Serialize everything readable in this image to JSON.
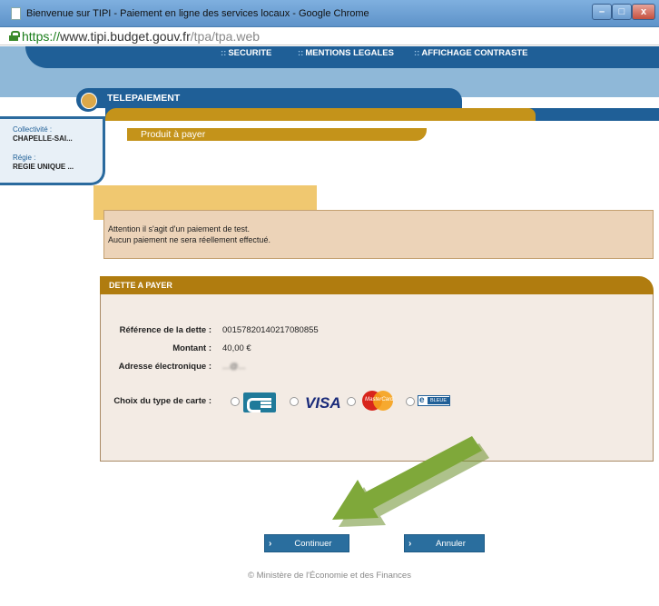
{
  "browser": {
    "title": "Bienvenue sur TIPI - Paiement en ligne des services locaux - Google Chrome",
    "url_scheme": "https://",
    "url_host": "www.tipi.budget.gouv.fr",
    "url_path": "/tpa/tpa.web",
    "min_label": "–",
    "max_label": "□",
    "close_label": "x"
  },
  "top_links": {
    "securite": "SECURITE",
    "mentions": "MENTIONS LEGALES",
    "affichage": "AFFICHAGE CONTRASTE",
    "dots": "::"
  },
  "sidebar": {
    "collectivite_label": "Collectivité :",
    "collectivite_value": "CHAPELLE-SAI...",
    "regie_label": "Régie :",
    "regie_value": "REGIE UNIQUE ..."
  },
  "header": {
    "tab_title": "TELEPAIEMENT",
    "product_label": "Produit à payer"
  },
  "warning": {
    "line1": "Attention il s'agit d'un paiement de test.",
    "line2": "Aucun paiement ne sera réellement effectué."
  },
  "debt": {
    "heading": "DETTE A PAYER",
    "ref_label": "Référence de la dette :",
    "ref_value": "00157820140217080855",
    "amount_label": "Montant :",
    "amount_value": "40,00 €",
    "email_label": "Adresse électronique :",
    "email_value": "...@...",
    "card_label": "Choix du type de carte :",
    "cards": {
      "visa": "VISA",
      "mastercard": "MasterCard",
      "ebleue_e": "e",
      "ebleue_b": "BLEUE"
    }
  },
  "actions": {
    "continue": "Continuer",
    "cancel": "Annuler",
    "chevron": "›"
  },
  "footer": "© Ministère de l'Économie et des Finances",
  "colors": {
    "brand_blue": "#1f5f97",
    "gold": "#c4931a",
    "arrow_green": "#7fa83a"
  }
}
